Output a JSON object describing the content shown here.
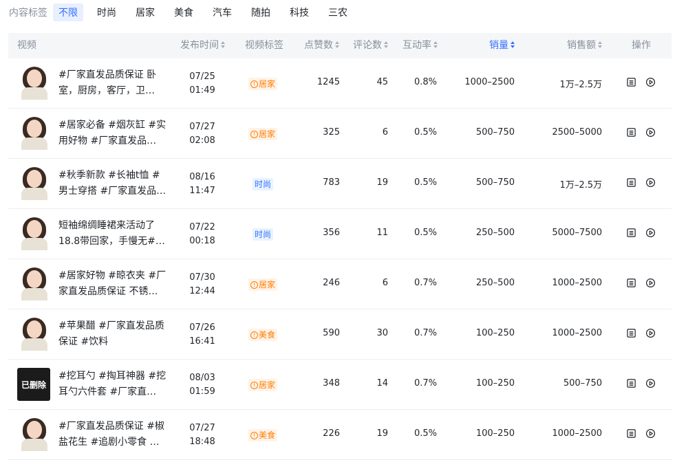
{
  "filter": {
    "label": "内容标签",
    "tags": [
      "不限",
      "时尚",
      "居家",
      "美食",
      "汽车",
      "随拍",
      "科技",
      "三农"
    ]
  },
  "columns": {
    "video": "视频",
    "publish_time": "发布时间",
    "video_tag": "视频标签",
    "likes": "点赞数",
    "comments": "评论数",
    "engagement": "互动率",
    "sales_volume": "销量",
    "sales_amount": "销售额",
    "actions": "操作"
  },
  "deleted_label": "已删除",
  "rows": [
    {
      "title": "#厂家直发品质保证 卧室，厨房，客厅，卫…",
      "date": "07/25",
      "time": "01:49",
      "tag": "居家",
      "tag_type": "warn",
      "likes": "1245",
      "comments": "45",
      "rate": "0.8%",
      "volume": "1000–2500",
      "amount": "1万–2.5万",
      "deleted": false
    },
    {
      "title": "#居家必备 #烟灰缸 #实用好物 #厂家直发品…",
      "date": "07/27",
      "time": "02:08",
      "tag": "居家",
      "tag_type": "warn",
      "likes": "325",
      "comments": "6",
      "rate": "0.5%",
      "volume": "500–750",
      "amount": "2500–5000",
      "deleted": false
    },
    {
      "title": "#秋季新款 #长袖t恤 #男士穿搭 #厂家直发品…",
      "date": "08/16",
      "time": "11:47",
      "tag": "时尚",
      "tag_type": "info",
      "likes": "783",
      "comments": "19",
      "rate": "0.5%",
      "volume": "500–750",
      "amount": "1万–2.5万",
      "deleted": false
    },
    {
      "title": "短袖绵绸睡裙来活动了 18.8带回家，手慢无#…",
      "date": "07/22",
      "time": "00:18",
      "tag": "时尚",
      "tag_type": "info",
      "likes": "356",
      "comments": "11",
      "rate": "0.5%",
      "volume": "250–500",
      "amount": "5000–7500",
      "deleted": false
    },
    {
      "title": "#居家好物 #晾衣夹 #厂家直发品质保证 不锈…",
      "date": "07/30",
      "time": "12:44",
      "tag": "居家",
      "tag_type": "warn",
      "likes": "246",
      "comments": "6",
      "rate": "0.7%",
      "volume": "250–500",
      "amount": "1000–2500",
      "deleted": false
    },
    {
      "title": "#苹果醋 #厂家直发品质保证 #饮料",
      "date": "07/26",
      "time": "16:41",
      "tag": "美食",
      "tag_type": "warn",
      "likes": "590",
      "comments": "30",
      "rate": "0.7%",
      "volume": "100–250",
      "amount": "1000–2500",
      "deleted": false
    },
    {
      "title": "#挖耳勺 #掏耳神器 #挖耳勺六件套 #厂家直…",
      "date": "08/03",
      "time": "01:59",
      "tag": "居家",
      "tag_type": "warn",
      "likes": "348",
      "comments": "14",
      "rate": "0.7%",
      "volume": "100–250",
      "amount": "500–750",
      "deleted": true
    },
    {
      "title": "#厂家直发品质保证 #椒盐花生 #追剧小零食 …",
      "date": "07/27",
      "time": "18:48",
      "tag": "美食",
      "tag_type": "warn",
      "likes": "226",
      "comments": "19",
      "rate": "0.5%",
      "volume": "100–250",
      "amount": "1000–2500",
      "deleted": false
    }
  ],
  "colors": {
    "accent": "#3370ff",
    "warn": "#ff7d00",
    "header_bg": "#f5f6f8",
    "muted": "#86909c"
  },
  "icons": {
    "detail": "list-detail-icon",
    "play": "play-circle-icon",
    "warn": "exclamation-circle-icon"
  }
}
